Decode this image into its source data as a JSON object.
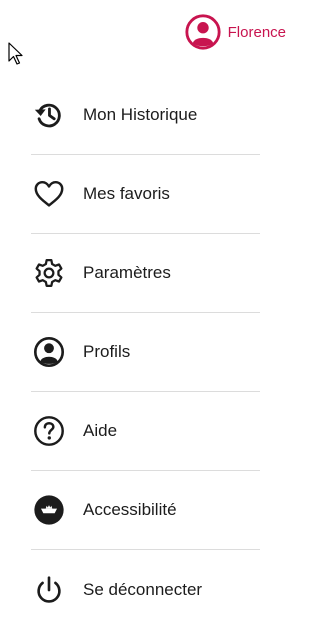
{
  "profile": {
    "name": "Florence",
    "icon": "user-circle-icon",
    "accent_color": "#c8144f"
  },
  "menu": {
    "items": [
      {
        "label": "Mon Historique",
        "icon": "history-icon"
      },
      {
        "label": "Mes favoris",
        "icon": "heart-icon"
      },
      {
        "label": "Paramètres",
        "icon": "gear-icon"
      },
      {
        "label": "Profils",
        "icon": "user-circle-icon"
      },
      {
        "label": "Aide",
        "icon": "help-icon"
      },
      {
        "label": "Accessibilité",
        "icon": "accessibility-icon"
      },
      {
        "label": "Se déconnecter",
        "icon": "power-icon"
      }
    ]
  },
  "colors": {
    "text": "#1c1c1c",
    "divider": "#dcdcdc",
    "background": "#ffffff"
  }
}
